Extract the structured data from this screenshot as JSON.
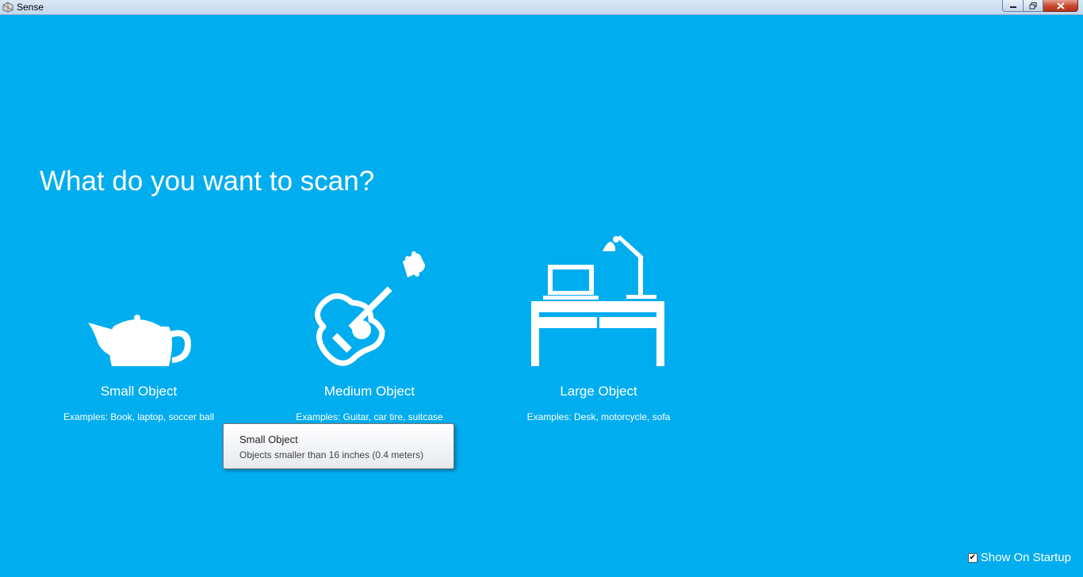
{
  "window": {
    "title": "Sense"
  },
  "main": {
    "heading": "What do you want to scan?",
    "options": [
      {
        "label": "Small Object",
        "examples": "Examples: Book, laptop, soccer ball",
        "icon": "teapot-icon"
      },
      {
        "label": "Medium Object",
        "examples": "Examples: Guitar, car tire, suitcase",
        "icon": "guitar-icon"
      },
      {
        "label": "Large Object",
        "examples": "Examples: Desk, motorcycle, sofa",
        "icon": "desk-icon"
      }
    ],
    "tooltip": {
      "title": "Small Object",
      "description": "Objects smaller than 16 inches (0.4 meters)"
    },
    "startup": {
      "label": "Show On Startup",
      "checked": true
    }
  },
  "colors": {
    "background": "#00adef",
    "foreground": "#ffffff"
  }
}
